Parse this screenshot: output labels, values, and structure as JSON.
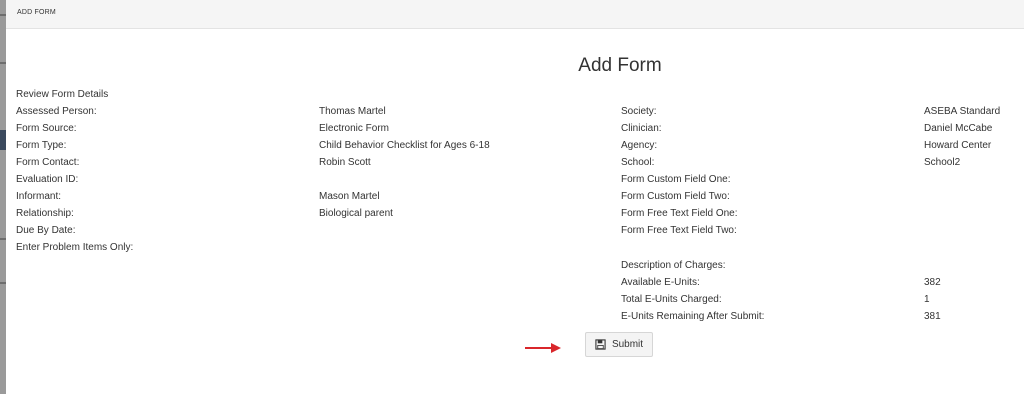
{
  "header": {
    "title": "ADD FORM"
  },
  "page_title": "Add Form",
  "section_title": "Review Form Details",
  "left_fields": [
    {
      "label": "Assessed Person:",
      "value": "Thomas Martel"
    },
    {
      "label": "Form Source:",
      "value": "Electronic Form"
    },
    {
      "label": "Form Type:",
      "value": "Child Behavior Checklist for Ages 6-18"
    },
    {
      "label": "Form Contact:",
      "value": "Robin Scott"
    },
    {
      "label": "Evaluation ID:",
      "value": ""
    },
    {
      "label": "Informant:",
      "value": "Mason Martel"
    },
    {
      "label": "Relationship:",
      "value": "Biological parent"
    },
    {
      "label": "Due By Date:",
      "value": ""
    },
    {
      "label": "Enter Problem Items Only:",
      "value": ""
    }
  ],
  "right_fields": [
    {
      "label": "Society:",
      "value": "ASEBA Standard"
    },
    {
      "label": "Clinician:",
      "value": "Daniel McCabe"
    },
    {
      "label": "Agency:",
      "value": "Howard Center"
    },
    {
      "label": "School:",
      "value": "School2"
    },
    {
      "label": "Form Custom Field One:",
      "value": ""
    },
    {
      "label": "Form Custom Field Two:",
      "value": ""
    },
    {
      "label": "Form Free Text Field One:",
      "value": ""
    },
    {
      "label": "Form Free Text Field Two:",
      "value": ""
    }
  ],
  "charges": [
    {
      "label": "Description of Charges:",
      "value": ""
    },
    {
      "label": "Available E-Units:",
      "value": "382"
    },
    {
      "label": "Total E-Units Charged:",
      "value": "1"
    },
    {
      "label": "E-Units Remaining After Submit:",
      "value": "381"
    }
  ],
  "submit": {
    "label": "Submit",
    "icon": "save-icon"
  },
  "colors": {
    "arrow": "#d9262b"
  }
}
